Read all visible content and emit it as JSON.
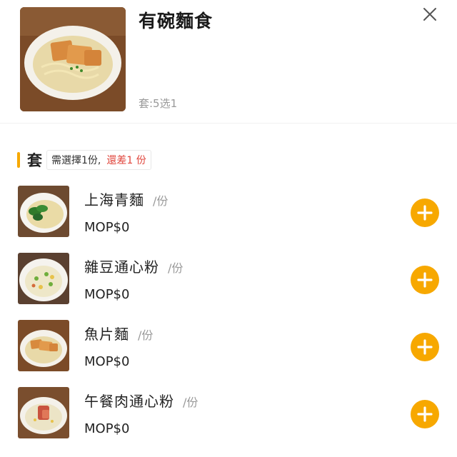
{
  "header": {
    "title": "有碗麵食",
    "subtitle": "套:5选1",
    "image": "fish-cake-noodle-photo",
    "close_icon": "close-icon"
  },
  "section": {
    "title": "套",
    "requirement": "需選擇1份,",
    "remaining": "還差1 份",
    "accent_color": "#f7a800",
    "remaining_color": "#e0463c"
  },
  "items": [
    {
      "name": "上海青麵",
      "unit": "/份",
      "price": "MOP$0",
      "image": "bok-choy-noodle-photo"
    },
    {
      "name": "雜豆通心粉",
      "unit": "/份",
      "price": "MOP$0",
      "image": "mixed-bean-macaroni-photo"
    },
    {
      "name": "魚片麵",
      "unit": "/份",
      "price": "MOP$0",
      "image": "fish-cake-noodle-photo"
    },
    {
      "name": "午餐肉通心粉",
      "unit": "/份",
      "price": "MOP$0",
      "image": "luncheon-meat-macaroni-photo"
    }
  ],
  "add_button_color": "#f7a800",
  "add_icon": "plus-icon"
}
